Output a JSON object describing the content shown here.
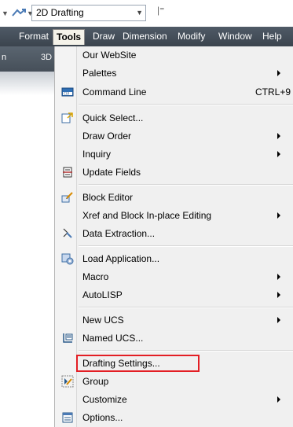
{
  "toolbar": {
    "workspace_value": "2D Drafting"
  },
  "menubar": {
    "items": [
      {
        "label": "Format"
      },
      {
        "label": "Tools"
      },
      {
        "label": "Draw"
      },
      {
        "label": "Dimension"
      },
      {
        "label": "Modify"
      },
      {
        "label": "Window"
      },
      {
        "label": "Help"
      }
    ]
  },
  "ribbon": {
    "left_label": "n",
    "right_label": "3D"
  },
  "tools_menu": {
    "items": [
      {
        "label": "Our WebSite",
        "shortcut": "",
        "submenu": false,
        "icon": ""
      },
      {
        "label": "Palettes",
        "shortcut": "",
        "submenu": true,
        "icon": ""
      },
      {
        "label": "Command Line",
        "shortcut": "CTRL+9",
        "submenu": false,
        "icon": "command-line-icon"
      },
      {
        "label": "Quick Select...",
        "shortcut": "",
        "submenu": false,
        "icon": "quick-select-icon"
      },
      {
        "label": "Draw Order",
        "shortcut": "",
        "submenu": true,
        "icon": ""
      },
      {
        "label": "Inquiry",
        "shortcut": "",
        "submenu": true,
        "icon": ""
      },
      {
        "label": "Update Fields",
        "shortcut": "",
        "submenu": false,
        "icon": "update-fields-icon"
      },
      {
        "label": "Block Editor",
        "shortcut": "",
        "submenu": false,
        "icon": "block-editor-icon"
      },
      {
        "label": "Xref and Block In-place Editing",
        "shortcut": "",
        "submenu": true,
        "icon": ""
      },
      {
        "label": "Data Extraction...",
        "shortcut": "",
        "submenu": false,
        "icon": "data-extraction-icon"
      },
      {
        "label": "Load Application...",
        "shortcut": "",
        "submenu": false,
        "icon": "load-application-icon"
      },
      {
        "label": "Macro",
        "shortcut": "",
        "submenu": true,
        "icon": ""
      },
      {
        "label": "AutoLISP",
        "shortcut": "",
        "submenu": true,
        "icon": ""
      },
      {
        "label": "New UCS",
        "shortcut": "",
        "submenu": true,
        "icon": ""
      },
      {
        "label": "Named UCS...",
        "shortcut": "",
        "submenu": false,
        "icon": "named-ucs-icon"
      },
      {
        "label": "Drafting Settings...",
        "shortcut": "",
        "submenu": false,
        "icon": "",
        "highlighted": true
      },
      {
        "label": "Group",
        "shortcut": "",
        "submenu": false,
        "icon": "group-icon"
      },
      {
        "label": "Customize",
        "shortcut": "",
        "submenu": true,
        "icon": ""
      },
      {
        "label": "Options...",
        "shortcut": "",
        "submenu": false,
        "icon": "options-icon"
      }
    ]
  },
  "colors": {
    "menubar_bg": "#454e58",
    "menu_bg": "#f0f0f0",
    "highlight_border": "#e31e24"
  }
}
